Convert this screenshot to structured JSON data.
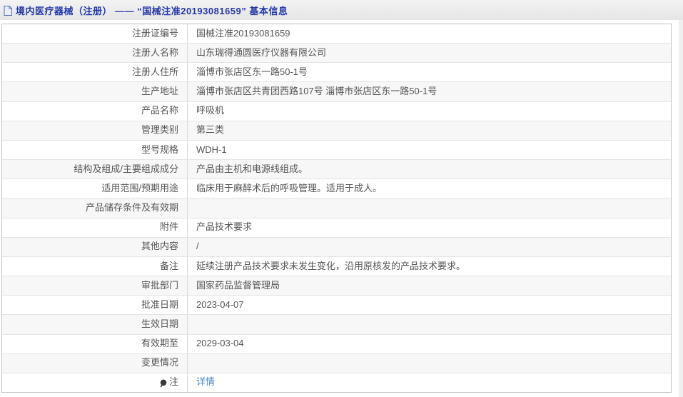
{
  "header": {
    "title": "境内医疗器械（注册） —— “国械注准20193081659” 基本信息",
    "icon": "document-icon"
  },
  "table": {
    "rows": [
      {
        "label": "注册证编号",
        "value": "国械注准20193081659"
      },
      {
        "label": "注册人名称",
        "value": "山东瑞得通圆医疗仪器有限公司"
      },
      {
        "label": "注册人住所",
        "value": "淄博市张店区东一路50-1号"
      },
      {
        "label": "生产地址",
        "value": "淄博市张店区共青团西路107号 淄博市张店区东一路50-1号"
      },
      {
        "label": "产品名称",
        "value": "呼吸机"
      },
      {
        "label": "管理类别",
        "value": "第三类"
      },
      {
        "label": "型号规格",
        "value": "WDH-1"
      },
      {
        "label": "结构及组成/主要组成成分",
        "value": "产品由主机和电源线组成。"
      },
      {
        "label": "适用范围/预期用途",
        "value": "临床用于麻醉术后的呼吸管理。适用于成人。"
      },
      {
        "label": "产品储存条件及有效期",
        "value": ""
      },
      {
        "label": "附件",
        "value": "产品技术要求"
      },
      {
        "label": "其他内容",
        "value": "/"
      },
      {
        "label": "备注",
        "value": "延续注册产品技术要求未发生变化，沿用原核发的产品技术要求。"
      },
      {
        "label": "审批部门",
        "value": "国家药品监督管理局"
      },
      {
        "label": "批准日期",
        "value": "2023-04-07"
      },
      {
        "label": "生效日期",
        "value": ""
      },
      {
        "label": "有效期至",
        "value": "2029-03-04"
      },
      {
        "label": "变更情况",
        "value": ""
      },
      {
        "label": "注",
        "value": "详情",
        "icon": "pin-icon",
        "link": true
      }
    ]
  },
  "colors": {
    "header_title": "#2438a8",
    "header_bg_top": "#f3f3f3",
    "header_bg_bottom": "#e5e5e5",
    "table_border": "#c3c3c3",
    "row_divider": "#e4e4e4",
    "column_divider": "#d9d9d9",
    "row_stripe": "#f7f7f7",
    "cell_text": "#555555",
    "link": "#4a86c8"
  }
}
